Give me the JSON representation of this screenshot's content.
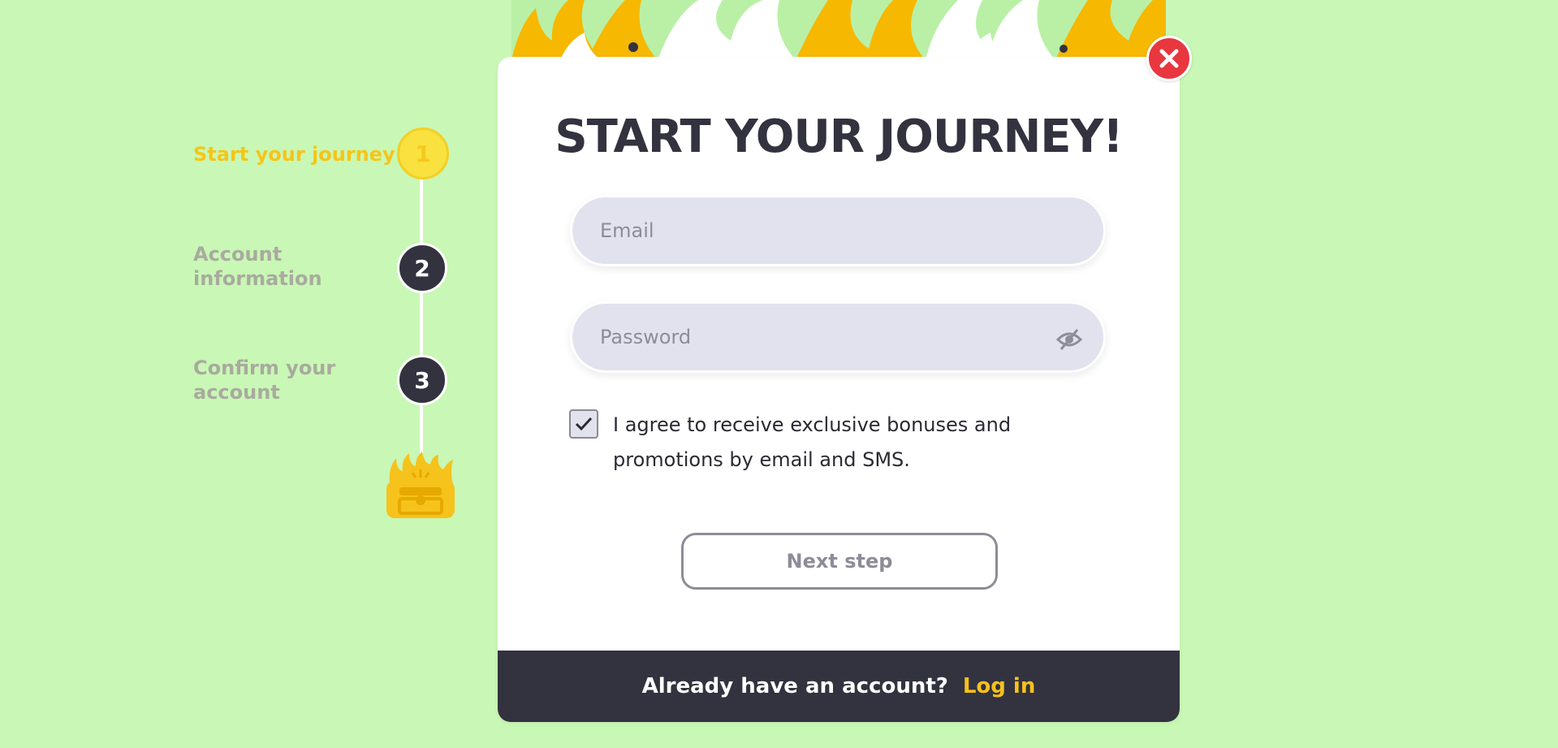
{
  "steps": [
    {
      "label": "Start your journey!",
      "number": "1",
      "state": "active"
    },
    {
      "label": "Account information",
      "number": "2",
      "state": "pending"
    },
    {
      "label": "Confirm your account",
      "number": "3",
      "state": "pending"
    }
  ],
  "modal": {
    "title": "START YOUR JOURNEY!",
    "email_placeholder": "Email",
    "password_placeholder": "Password",
    "agree_text": "I agree to receive exclusive bonuses and promotions by email and SMS.",
    "agree_checked": true,
    "next_label": "Next step",
    "footer_question": "Already have an account?",
    "login_label": "Log in"
  },
  "colors": {
    "background": "#c9f7b5",
    "accent": "#f6c21c",
    "dark": "#33323f",
    "close": "#e8373f"
  },
  "icons": [
    "close-icon",
    "eye-off-icon",
    "check-icon",
    "treasure-chest-icon",
    "flame-banner"
  ]
}
